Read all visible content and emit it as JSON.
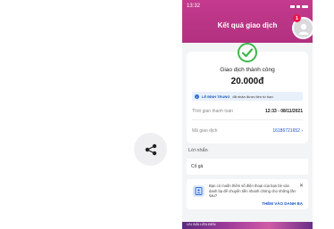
{
  "share": {
    "icon": "share-icon"
  },
  "header": {
    "title": "Kết quả giao dịch",
    "status_time": "13:32",
    "notification_count": "1"
  },
  "result": {
    "status_text": "Giao dịch thành công",
    "amount": "20.000đ",
    "notice_name": "LÊ ĐÌNH TRUNG",
    "notice_text": "đã nhận được tiền từ bạn",
    "time_label": "Thời gian thanh toán",
    "time_value": "12:33 - 08/11/2021",
    "code_label": "Mã giao dịch",
    "code_value": "16186721652"
  },
  "message": {
    "label": "Lời nhắn",
    "value": "Cố gà"
  },
  "contact_prompt": {
    "text": "Bạn có muốn thêm số điện thoại của bạn bè vào danh bạ để chuyển tiền nhanh chóng cho những lần sau?",
    "action": "THÊM VÀO DANH BẠ"
  },
  "banner": {
    "text": "ƯU ĐÃI LÊN ĐẾN"
  },
  "colors": {
    "brand": "#b2307f",
    "success": "#3cb84a",
    "link": "#1a57c2"
  }
}
